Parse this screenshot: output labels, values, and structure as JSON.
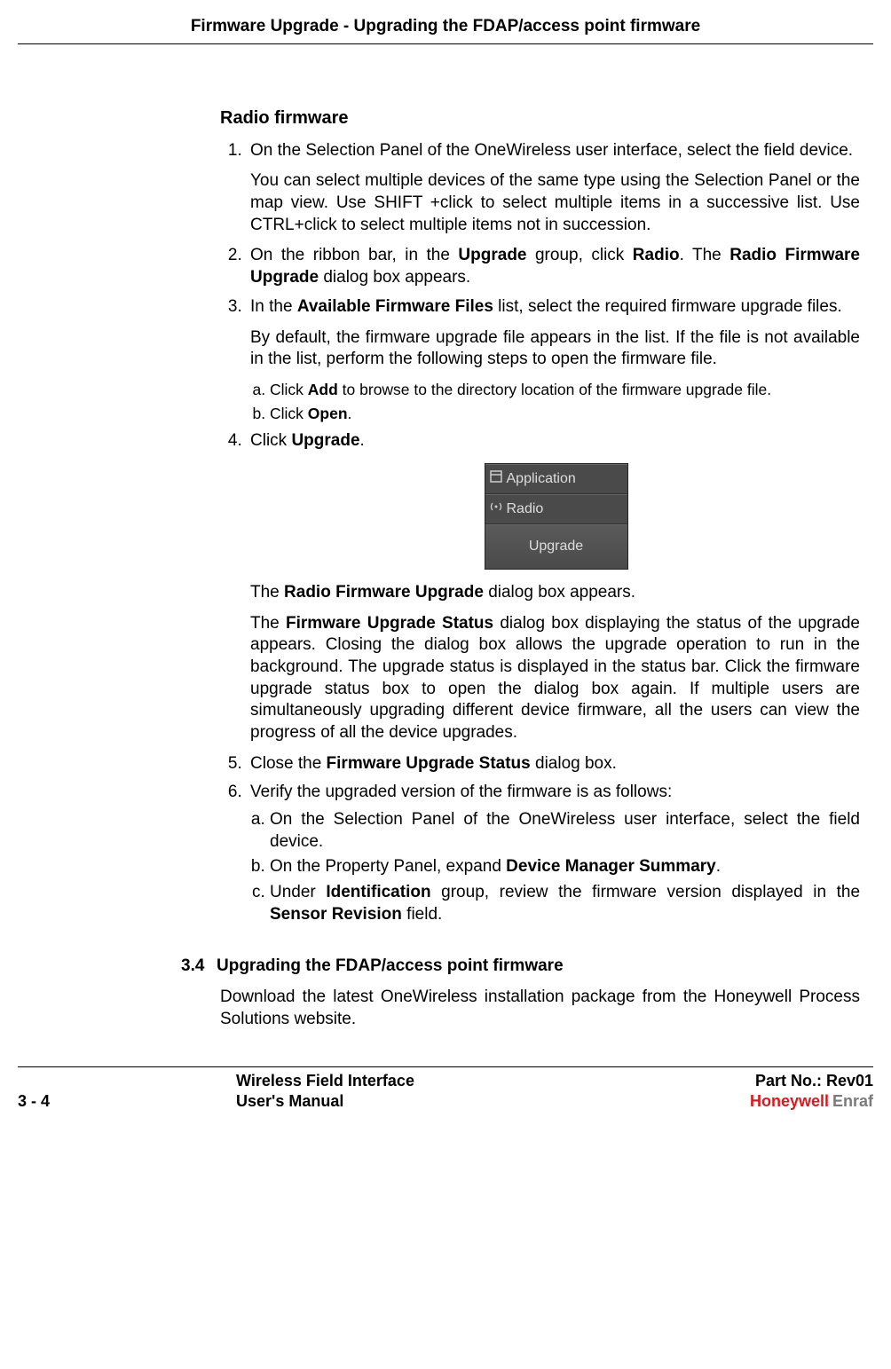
{
  "header": {
    "title": "Firmware Upgrade - Upgrading the FDAP/access point firmware"
  },
  "section": {
    "subheading": "Radio firmware",
    "step1_a": "On the Selection Panel of the OneWireless user interface, select the field device.",
    "step1_b": "You can select multiple devices of the same type using the Selection Panel or the map view. Use SHIFT +click to select multiple items in a successive list. Use CTRL+click to select multiple items not in succession.",
    "step2_pre": "On the ribbon bar, in the ",
    "step2_b1": "Upgrade",
    "step2_mid1": " group, click ",
    "step2_b2": "Radio",
    "step2_mid2": ". The ",
    "step2_b3": "Radio Firmware Upgrade",
    "step2_post": " dialog box appears.",
    "step3_pre": "In the ",
    "step3_b1": "Available Firmware Files",
    "step3_post": " list, select the required firmware upgrade files.",
    "step3_p": "By default, the firmware upgrade file appears in the list. If the file is not available in the list, perform the following steps to open the firmware file.",
    "step3a_pre": "Click ",
    "step3a_b": "Add",
    "step3a_post": " to browse to the directory location of the firmware upgrade file.",
    "step3b_pre": "Click ",
    "step3b_b": "Open",
    "step3b_post": ".",
    "step4_pre": "Click ",
    "step4_b": "Upgrade",
    "step4_post": ".",
    "panel": {
      "row1": "Application",
      "row2": "Radio",
      "button": "Upgrade"
    },
    "after_fig_1_pre": "The ",
    "after_fig_1_b": "Radio Firmware Upgrade",
    "after_fig_1_post": " dialog box appears.",
    "after_fig_2_pre": "The ",
    "after_fig_2_b": "Firmware Upgrade Status",
    "after_fig_2_post": " dialog box displaying the status of the upgrade appears. Closing the dialog box allows the upgrade operation to run in the background. The upgrade status is displayed in the status bar. Click the firmware upgrade status box to open the dialog box again. If multiple users are simultaneously upgrading different device firmware, all the users can view the progress of all the device upgrades.",
    "step5_pre": "Close the ",
    "step5_b": "Firmware Upgrade Status",
    "step5_post": " dialog box.",
    "step6": "Verify the upgraded version of the firmware is as follows:",
    "step6a": "On the Selection Panel of the OneWireless user interface, select the field device.",
    "step6b_pre": "On the Property Panel, expand ",
    "step6b_b": "Device Manager Summary",
    "step6b_post": ".",
    "step6c_pre": "Under ",
    "step6c_b1": "Identification",
    "step6c_mid": " group, review the firmware version displayed in the ",
    "step6c_b2": "Sensor Revision",
    "step6c_post": " field."
  },
  "section34": {
    "num": "3.4",
    "title": "Upgrading the FDAP/access point firmware",
    "para": "Download the latest OneWireless installation package from the Honeywell Process Solutions website."
  },
  "footer": {
    "page": "3 - 4",
    "mid1": "Wireless Field Interface",
    "mid2": "User's Manual",
    "right1": "Part No.: Rev01",
    "brand1": "Honeywell",
    "brand2": "Enraf"
  }
}
